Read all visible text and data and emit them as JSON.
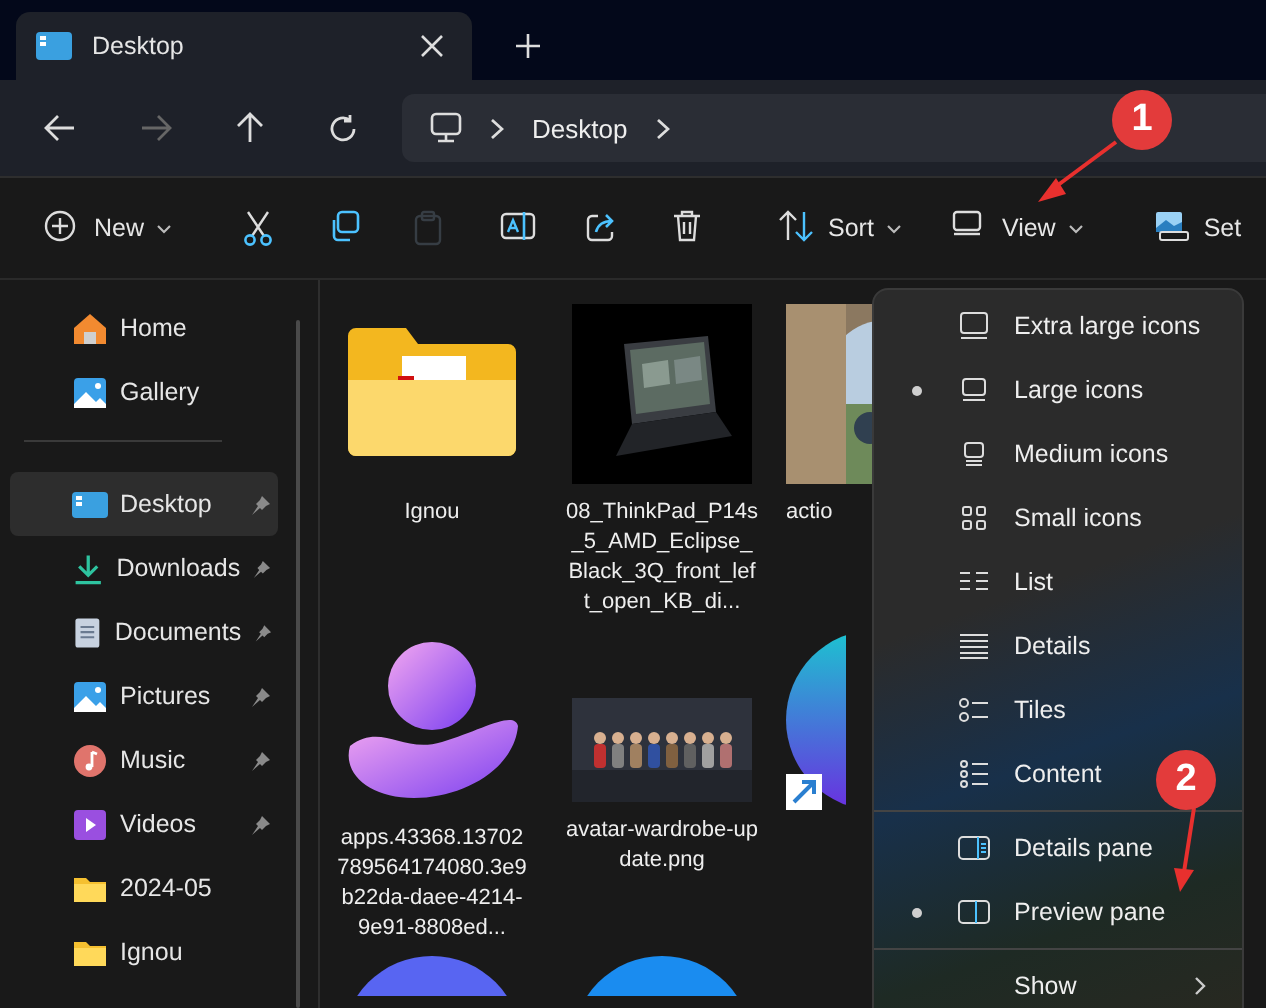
{
  "tab": {
    "title": "Desktop"
  },
  "nav": {
    "forward_disabled": true,
    "breadcrumb": [
      "Desktop"
    ]
  },
  "toolbar": [
    {
      "kind": "new",
      "label": "New",
      "disabled": false
    },
    {
      "kind": "divider"
    },
    {
      "kind": "cut",
      "disabled": false
    },
    {
      "kind": "copy",
      "disabled": false
    },
    {
      "kind": "paste",
      "disabled": true
    },
    {
      "kind": "rename",
      "disabled": false
    },
    {
      "kind": "share",
      "disabled": false
    },
    {
      "kind": "delete",
      "disabled": false
    },
    {
      "kind": "divider"
    },
    {
      "kind": "sort",
      "label": "Sort",
      "disabled": false
    },
    {
      "kind": "view",
      "label": "View",
      "disabled": false
    },
    {
      "kind": "divider"
    },
    {
      "kind": "settings",
      "label": "Set",
      "disabled": false
    }
  ],
  "sidebar": {
    "top": [
      {
        "label": "Home",
        "kind": "home",
        "selected": false,
        "pinned": false
      },
      {
        "label": "Gallery",
        "kind": "gallery",
        "selected": false,
        "pinned": false
      }
    ],
    "items": [
      {
        "label": "Desktop",
        "kind": "desktop",
        "selected": true,
        "pinned": true
      },
      {
        "label": "Downloads",
        "kind": "downloads",
        "selected": false,
        "pinned": true
      },
      {
        "label": "Documents",
        "kind": "documents",
        "selected": false,
        "pinned": true
      },
      {
        "label": "Pictures",
        "kind": "pictures",
        "selected": false,
        "pinned": true
      },
      {
        "label": "Music",
        "kind": "music",
        "selected": false,
        "pinned": true
      },
      {
        "label": "Videos",
        "kind": "videos",
        "selected": false,
        "pinned": true
      },
      {
        "label": "2024-05",
        "kind": "folder",
        "selected": false,
        "pinned": false
      },
      {
        "label": "Ignou",
        "kind": "folder",
        "selected": false,
        "pinned": false
      }
    ]
  },
  "files": [
    {
      "name": "Ignou",
      "kind": "folder"
    },
    {
      "name": "08_ThinkPad_P14s_5_AMD_Eclipse_Black_3Q_front_left_open_KB_di...",
      "kind": "picture"
    },
    {
      "name": "actio",
      "kind": "picture"
    },
    {
      "name": "apps.43368.13702789564174080.3e9b22da-daee-4214-9e91-8808ed...",
      "kind": "app"
    },
    {
      "name": "avatar-wardrobe-update.png",
      "kind": "picture"
    },
    {
      "kind": "shortcut"
    },
    {
      "kind": "round_app"
    },
    {
      "kind": "round_app"
    }
  ],
  "view_menu": [
    {
      "kind": "item",
      "label": "Extra large icons",
      "selected": false
    },
    {
      "kind": "item",
      "label": "Large icons",
      "selected": true
    },
    {
      "kind": "item",
      "label": "Medium icons",
      "selected": false
    },
    {
      "kind": "item",
      "label": "Small icons",
      "selected": false
    },
    {
      "kind": "item",
      "label": "List",
      "selected": false
    },
    {
      "kind": "item",
      "label": "Details",
      "selected": false
    },
    {
      "kind": "item",
      "label": "Tiles",
      "selected": false
    },
    {
      "kind": "item",
      "label": "Content",
      "selected": false
    },
    {
      "kind": "separator"
    },
    {
      "kind": "item",
      "label": "Details pane",
      "selected": false
    },
    {
      "kind": "item",
      "label": "Preview pane",
      "selected": true
    },
    {
      "kind": "separator"
    },
    {
      "kind": "submenu",
      "label": "Show"
    }
  ],
  "annotations": [
    {
      "label": "1"
    },
    {
      "label": "2"
    }
  ]
}
